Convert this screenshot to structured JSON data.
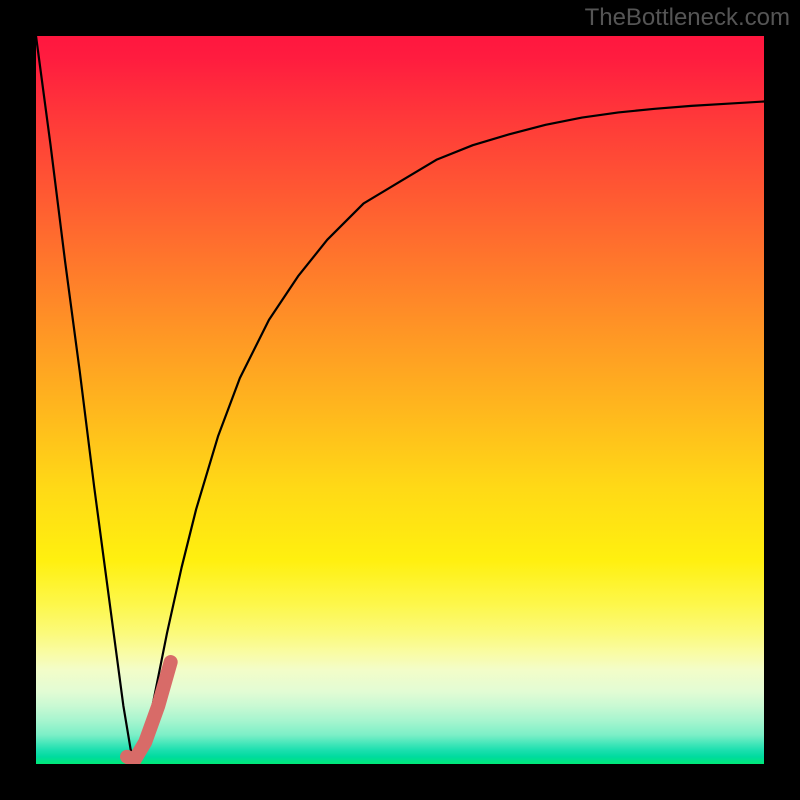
{
  "watermark": "TheBottleneck.com",
  "colors": {
    "frame": "#000000",
    "curve_main": "#000000",
    "curve_accent": "#d86b68",
    "watermark": "#555555"
  },
  "chart_data": {
    "type": "line",
    "title": "",
    "xlabel": "",
    "ylabel": "",
    "xlim": [
      0,
      100
    ],
    "ylim": [
      0,
      100
    ],
    "grid": false,
    "legend": false,
    "series": [
      {
        "name": "main-curve",
        "color": "#000000",
        "x": [
          0,
          2,
          4,
          6,
          8,
          10,
          12,
          13,
          14,
          15,
          16,
          18,
          20,
          22,
          25,
          28,
          32,
          36,
          40,
          45,
          50,
          55,
          60,
          65,
          70,
          75,
          80,
          85,
          90,
          95,
          100
        ],
        "y": [
          100,
          85,
          69,
          54,
          38,
          23,
          8,
          2,
          0,
          3,
          8,
          18,
          27,
          35,
          45,
          53,
          61,
          67,
          72,
          77,
          80,
          83,
          85,
          86.5,
          87.8,
          88.8,
          89.5,
          90,
          90.4,
          90.7,
          91
        ]
      },
      {
        "name": "accent-segment",
        "color": "#d86b68",
        "x": [
          12.5,
          13.5,
          15.0,
          16.8,
          18.5
        ],
        "y": [
          1.0,
          0.5,
          3.0,
          8.0,
          14.0
        ]
      }
    ],
    "annotations": []
  }
}
